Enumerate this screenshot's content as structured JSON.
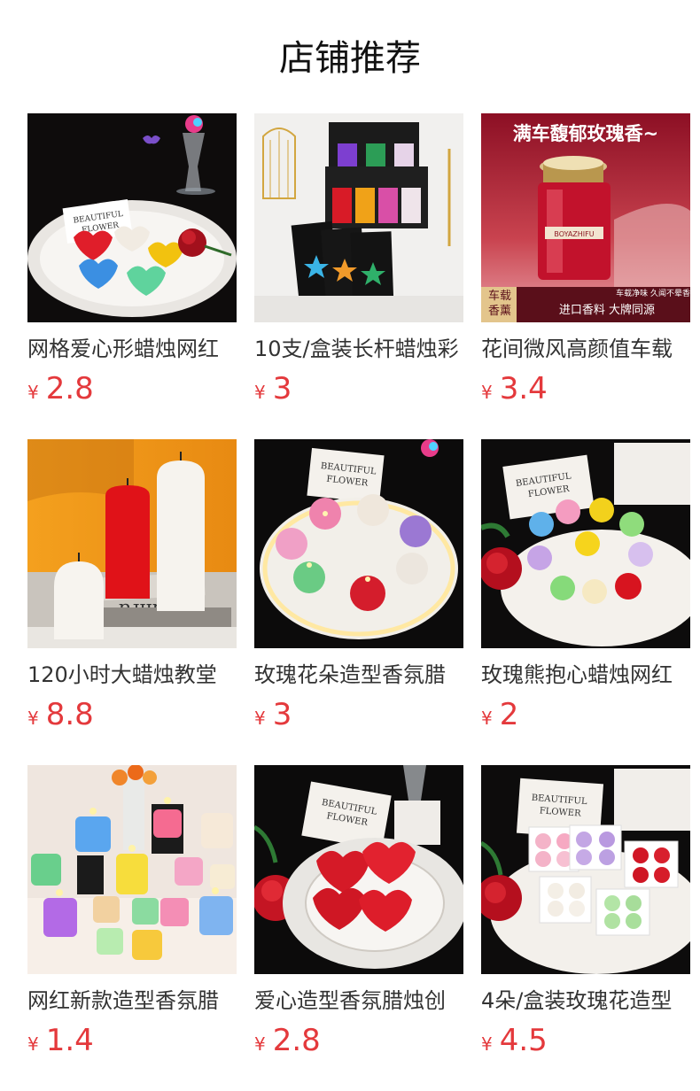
{
  "page": {
    "title": "店铺推荐"
  },
  "currency_symbol": "¥",
  "accent_color": "#e4393c",
  "products": [
    {
      "name": "网格爱心形蜡烛网红",
      "price": "2.8"
    },
    {
      "name": "10支/盒装长杆蜡烛彩",
      "price": "3"
    },
    {
      "name": "花间微风高颜值车载",
      "price": "3.4",
      "image_text": {
        "banner": "满车馥郁玫瑰香~",
        "brand": "BOYAZHIFU",
        "side_badge": "车载香薰",
        "tags": "车载净味 久闻不晕香",
        "footer": "进口香料 大牌同源"
      }
    },
    {
      "name": "120小时大蜡烛教堂",
      "price": "8.8",
      "image_text": {
        "book": "ianra"
      }
    },
    {
      "name": "玫瑰花朵造型香氛腊",
      "price": "3"
    },
    {
      "name": "玫瑰熊抱心蜡烛网红",
      "price": "2"
    },
    {
      "name": "网红新款造型香氛腊",
      "price": "1.4"
    },
    {
      "name": "爱心造型香氛腊烛创",
      "price": "2.8"
    },
    {
      "name": "4朵/盒装玫瑰花造型",
      "price": "4.5"
    }
  ]
}
